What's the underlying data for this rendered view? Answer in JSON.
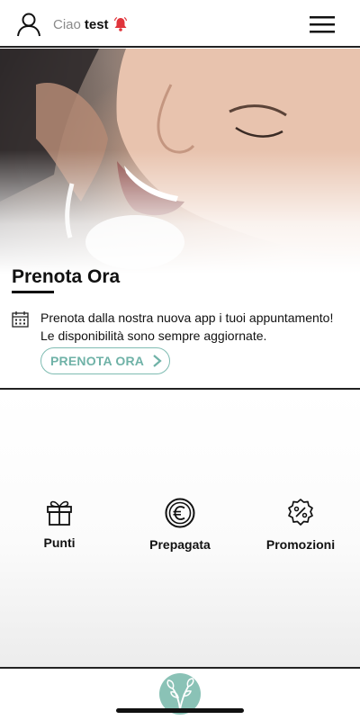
{
  "header": {
    "greeting": "Ciao",
    "username": "test",
    "icons": {
      "user": "user-icon",
      "bell": "bell-icon",
      "menu": "hamburger-menu-icon"
    },
    "bell_color": "#e0343b"
  },
  "booking": {
    "title": "Prenota Ora",
    "description": "Prenota dalla nostra nuova app i tuoi appuntamento! Le disponibilità sono sempre aggiornate.",
    "button_label": "PRENOTA ORA",
    "accent_color": "#6fb2a7"
  },
  "menu": {
    "items": [
      {
        "label": "Punti",
        "icon": "gift-icon"
      },
      {
        "label": "Prepagata",
        "icon": "euro-coin-icon"
      },
      {
        "label": "Promozioni",
        "icon": "discount-badge-icon"
      }
    ]
  },
  "bottom_nav": {
    "icon": "leaf-logo-icon",
    "color": "#8ac2b6"
  }
}
